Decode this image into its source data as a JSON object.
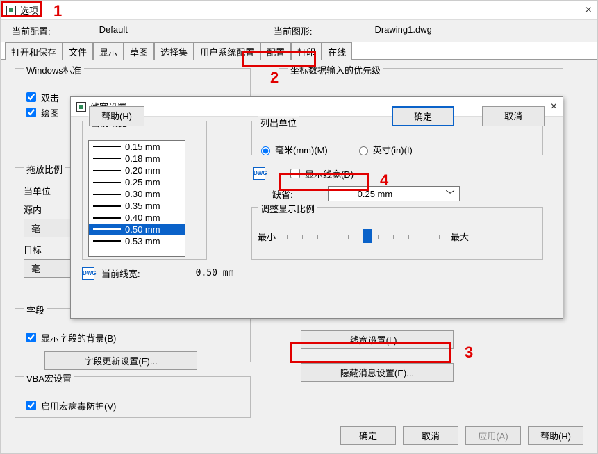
{
  "main": {
    "title": "选项",
    "close_glyph": "×",
    "config_label": "当前配置:",
    "config_value": "Default",
    "drawing_label": "当前图形:",
    "drawing_value": "Drawing1.dwg",
    "tabs": [
      "打开和保存",
      "文件",
      "显示",
      "草图",
      "选择集",
      "用户系统配置",
      "配置",
      "打印",
      "在线"
    ]
  },
  "groups": {
    "windows_std": "Windows标准",
    "doubleclick": "双击",
    "paint": "绘图",
    "drag_scale": "拖放比例",
    "unit_label": "当单位",
    "source_label": "源内",
    "src_btn": "毫",
    "target_label": "目标",
    "tgt_btn": "毫",
    "fields": "字段",
    "show_field_bg": "显示字段的背景(B)",
    "field_update_btn": "字段更新设置(F)...",
    "vba": "VBA宏设置",
    "enable_virus": "启用宏病毒防护(V)",
    "coord": "坐标数据输入的优先级",
    "lw_btn": "线宽设置(L)...",
    "hide_msg_btn": "隐藏消息设置(E)..."
  },
  "dialog": {
    "title": "线宽设置",
    "close_glyph": "×",
    "current_lw_group": "当前线宽",
    "items": [
      "0.15 mm",
      "0.18 mm",
      "0.20 mm",
      "0.25 mm",
      "0.30 mm",
      "0.35 mm",
      "0.40 mm",
      "0.50 mm",
      "0.53 mm"
    ],
    "selected_index": 7,
    "dwg_icon": "DWG",
    "current_lw_label": "当前线宽:",
    "current_lw_value": "0.50 mm",
    "units_group": "列出单位",
    "unit_mm": "毫米(mm)(M)",
    "unit_in": "英寸(in)(I)",
    "show_lw": "显示线宽(D)",
    "default_label": "缺省:",
    "default_value": "0.25 mm",
    "adjust_label": "调整显示比例",
    "min": "最小",
    "max": "最大",
    "help": "帮助(H)",
    "ok": "确定",
    "cancel": "取消"
  },
  "bottom": {
    "ok": "确定",
    "cancel": "取消",
    "apply": "应用(A)",
    "help": "帮助(H)"
  },
  "ann": {
    "1": "1",
    "2": "2",
    "3": "3",
    "4": "4"
  }
}
